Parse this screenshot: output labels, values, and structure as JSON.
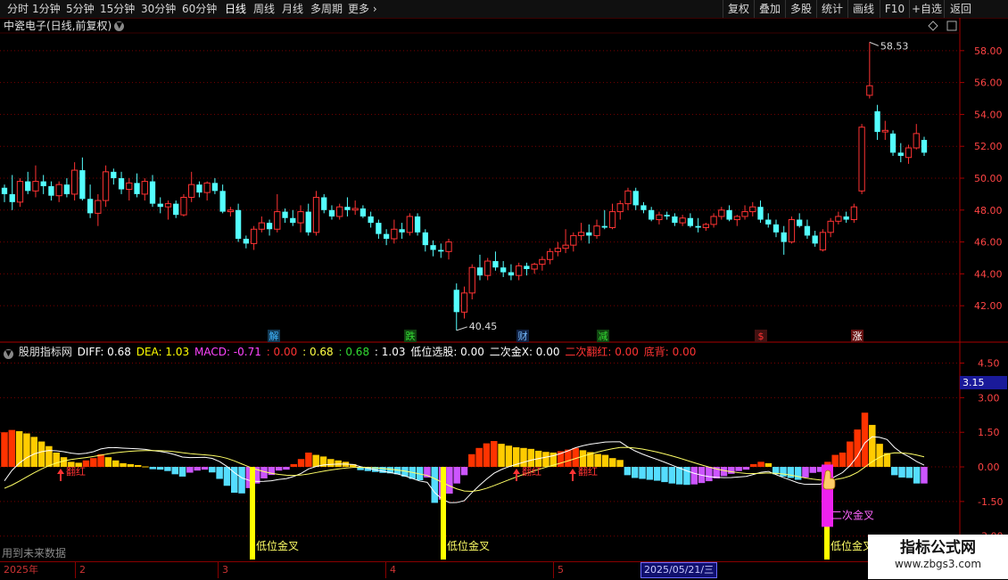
{
  "toolbar": {
    "left": [
      "分时",
      "1分钟",
      "5分钟",
      "15分钟",
      "30分钟",
      "60分钟",
      "日线",
      "周线",
      "月线",
      "多周期",
      "更多"
    ],
    "active": "日线",
    "right": [
      "复权",
      "叠加",
      "多股",
      "统计",
      "画线",
      "F10",
      "+自选",
      "返回"
    ]
  },
  "stock": {
    "title": "中瓷电子(日线,前复权)",
    "high_label": "58.53",
    "low_label": "40.45"
  },
  "price_axis": [
    "58.00",
    "56.00",
    "54.00",
    "52.00",
    "50.00",
    "48.00",
    "46.00",
    "44.00",
    "42.00"
  ],
  "markers": [
    {
      "text": "解",
      "color": "#3fb6ff",
      "bg": "#133a55"
    },
    {
      "text": "跌",
      "color": "#33dd33",
      "bg": "#114411"
    },
    {
      "text": "财",
      "color": "#77bbff",
      "bg": "#112244"
    },
    {
      "text": "减",
      "color": "#33dd33",
      "bg": "#114411"
    },
    {
      "text": "$",
      "color": "#ff3333",
      "bg": "#441111"
    },
    {
      "text": "涨",
      "color": "#ffffff",
      "bg": "#661111"
    }
  ],
  "indicator": {
    "name": "股朋指标网",
    "diff": "DIFF: 0.68",
    "dea": "DEA: 1.03",
    "macd": "MACD: -0.71",
    "v1": ": 0.00",
    "v2": ": 0.68",
    "v3": ": 0.68",
    "v4": ": 1.03",
    "low_pick": "低位选股: 0.00",
    "second_cross": "二次金X: 0.00",
    "second_red": "二次翻红: 0.00",
    "bottom_div": "底背: 0.00"
  },
  "ind_axis": [
    "4.50",
    "3.00",
    "1.50",
    "0.00",
    "-1.50",
    "-3.00"
  ],
  "ind_current": "3.15",
  "signals": {
    "flip_red": "翻红",
    "low_cross": "低位金叉",
    "second_cross": "二次金叉"
  },
  "future_note": "用到未来数据",
  "time_axis": {
    "labels": [
      "2025年",
      "2",
      "3",
      "4",
      "5"
    ],
    "current_date": "2025/05/21/三"
  },
  "watermark": {
    "line1": "指标公式网",
    "line2": "www.zbgs3.com"
  },
  "colors": {
    "up": "#ff3333",
    "down": "#54ffff",
    "grid": "#7a0000"
  },
  "chart_data": [
    {
      "type": "candlestick",
      "title": "中瓷电子(日线,前复权)",
      "ylim": [
        40.5,
        59.5
      ],
      "annotations": [
        {
          "text": "58.53",
          "value": 58.53
        },
        {
          "text": "40.45",
          "value": 40.45
        }
      ],
      "ohlc": [
        [
          49.4,
          49.6,
          48.5,
          49.0
        ],
        [
          49.0,
          50.2,
          48.0,
          48.5
        ],
        [
          48.5,
          50.0,
          48.2,
          49.8
        ],
        [
          49.8,
          50.4,
          49.0,
          49.2
        ],
        [
          49.2,
          50.8,
          48.8,
          49.8
        ],
        [
          49.8,
          50.2,
          49.0,
          49.5
        ],
        [
          49.5,
          49.8,
          48.6,
          48.9
        ],
        [
          48.9,
          49.8,
          48.5,
          49.6
        ],
        [
          49.6,
          50.0,
          48.8,
          49.0
        ],
        [
          49.0,
          51.0,
          48.6,
          50.5
        ],
        [
          50.5,
          51.3,
          48.6,
          48.7
        ],
        [
          48.7,
          49.6,
          47.5,
          47.8
        ],
        [
          47.8,
          49.0,
          47.0,
          48.6
        ],
        [
          48.6,
          50.8,
          48.2,
          50.4
        ],
        [
          50.4,
          50.6,
          49.6,
          50.0
        ],
        [
          50.0,
          50.4,
          49.0,
          49.3
        ],
        [
          49.3,
          50.0,
          48.6,
          49.7
        ],
        [
          49.7,
          50.3,
          48.8,
          49.0
        ],
        [
          49.0,
          50.0,
          48.6,
          49.8
        ],
        [
          49.8,
          50.2,
          48.2,
          48.4
        ],
        [
          48.4,
          48.8,
          47.8,
          48.2
        ],
        [
          48.2,
          48.6,
          47.4,
          48.4
        ],
        [
          48.4,
          48.6,
          47.5,
          47.7
        ],
        [
          47.7,
          49.0,
          47.6,
          48.8
        ],
        [
          48.8,
          50.4,
          48.5,
          49.6
        ],
        [
          49.6,
          49.8,
          48.8,
          49.1
        ],
        [
          49.1,
          49.8,
          48.6,
          49.7
        ],
        [
          49.7,
          50.0,
          49.0,
          49.2
        ],
        [
          49.2,
          49.6,
          47.8,
          47.9
        ],
        [
          47.9,
          48.2,
          47.6,
          48.0
        ],
        [
          48.0,
          48.4,
          46.0,
          46.2
        ],
        [
          46.2,
          46.4,
          45.6,
          45.9
        ],
        [
          45.9,
          47.0,
          45.5,
          46.8
        ],
        [
          46.8,
          47.6,
          46.6,
          47.2
        ],
        [
          47.2,
          47.4,
          46.4,
          46.8
        ],
        [
          46.8,
          49.0,
          46.6,
          47.9
        ],
        [
          47.9,
          48.1,
          47.2,
          47.5
        ],
        [
          47.5,
          48.0,
          47.0,
          47.2
        ],
        [
          47.2,
          48.3,
          46.6,
          47.9
        ],
        [
          47.9,
          48.4,
          46.4,
          46.6
        ],
        [
          46.6,
          49.2,
          46.4,
          48.8
        ],
        [
          48.8,
          49.0,
          47.8,
          48.0
        ],
        [
          48.0,
          48.3,
          47.4,
          47.6
        ],
        [
          47.6,
          48.4,
          47.4,
          48.2
        ],
        [
          48.2,
          48.8,
          47.6,
          48.0
        ],
        [
          48.0,
          48.6,
          47.7,
          48.1
        ],
        [
          48.1,
          48.3,
          47.5,
          47.6
        ],
        [
          47.6,
          47.9,
          46.9,
          47.2
        ],
        [
          47.2,
          47.4,
          46.2,
          46.5
        ],
        [
          46.5,
          46.8,
          45.8,
          46.2
        ],
        [
          46.2,
          47.4,
          45.9,
          46.8
        ],
        [
          46.8,
          47.2,
          46.2,
          46.6
        ],
        [
          46.6,
          47.8,
          46.4,
          47.6
        ],
        [
          47.6,
          47.8,
          46.4,
          46.6
        ],
        [
          46.6,
          46.8,
          45.4,
          45.8
        ],
        [
          45.8,
          46.1,
          45.1,
          45.5
        ],
        [
          45.5,
          45.9,
          45.0,
          45.4
        ],
        [
          45.4,
          46.2,
          44.9,
          46.0
        ],
        [
          43.0,
          43.4,
          40.45,
          41.6
        ],
        [
          41.6,
          43.2,
          41.2,
          42.8
        ],
        [
          42.8,
          44.6,
          42.4,
          44.4
        ],
        [
          44.4,
          45.2,
          43.6,
          43.9
        ],
        [
          43.9,
          45.0,
          43.6,
          44.8
        ],
        [
          44.8,
          45.4,
          44.2,
          44.4
        ],
        [
          44.4,
          44.8,
          43.8,
          44.1
        ],
        [
          44.1,
          44.6,
          43.6,
          43.9
        ],
        [
          43.9,
          44.7,
          43.6,
          44.5
        ],
        [
          44.5,
          44.7,
          43.9,
          44.3
        ],
        [
          44.3,
          44.7,
          44.0,
          44.6
        ],
        [
          44.6,
          45.1,
          44.2,
          44.9
        ],
        [
          44.9,
          45.6,
          44.6,
          45.4
        ],
        [
          45.4,
          46.0,
          45.1,
          45.6
        ],
        [
          45.6,
          46.8,
          45.3,
          45.8
        ],
        [
          45.8,
          46.6,
          45.4,
          46.4
        ],
        [
          46.4,
          47.2,
          46.1,
          46.6
        ],
        [
          46.6,
          47.1,
          45.9,
          46.4
        ],
        [
          46.4,
          47.4,
          46.2,
          47.0
        ],
        [
          47.0,
          48.0,
          46.8,
          46.9
        ],
        [
          46.9,
          48.4,
          46.8,
          47.9
        ],
        [
          47.9,
          48.6,
          47.4,
          48.4
        ],
        [
          48.4,
          49.4,
          48.0,
          49.2
        ],
        [
          49.2,
          49.4,
          48.0,
          48.3
        ],
        [
          48.3,
          48.5,
          47.8,
          48.0
        ],
        [
          48.0,
          48.2,
          47.3,
          47.4
        ],
        [
          47.4,
          47.9,
          47.1,
          47.7
        ],
        [
          47.7,
          47.9,
          47.4,
          47.6
        ],
        [
          47.6,
          47.8,
          47.0,
          47.2
        ],
        [
          47.2,
          47.7,
          47.0,
          47.5
        ],
        [
          47.5,
          47.8,
          46.9,
          47.0
        ],
        [
          47.0,
          47.5,
          46.6,
          46.9
        ],
        [
          46.9,
          47.2,
          46.7,
          47.1
        ],
        [
          47.1,
          47.8,
          46.9,
          47.6
        ],
        [
          47.6,
          48.2,
          47.4,
          48.0
        ],
        [
          48.0,
          48.3,
          47.3,
          47.4
        ],
        [
          47.4,
          47.7,
          47.0,
          47.6
        ],
        [
          47.6,
          48.3,
          47.4,
          47.9
        ],
        [
          47.9,
          48.5,
          47.6,
          48.2
        ],
        [
          48.2,
          48.6,
          47.2,
          47.4
        ],
        [
          47.4,
          47.8,
          46.9,
          47.1
        ],
        [
          47.1,
          47.4,
          46.3,
          46.6
        ],
        [
          46.6,
          47.0,
          45.2,
          46.0
        ],
        [
          46.0,
          47.6,
          45.9,
          47.4
        ],
        [
          47.4,
          47.8,
          46.9,
          47.0
        ],
        [
          47.0,
          47.4,
          46.2,
          46.4
        ],
        [
          46.4,
          46.7,
          45.7,
          45.9
        ],
        [
          45.5,
          46.8,
          45.4,
          46.6
        ],
        [
          46.6,
          47.5,
          46.3,
          47.3
        ],
        [
          47.3,
          47.9,
          47.1,
          47.6
        ],
        [
          47.6,
          47.9,
          47.2,
          47.4
        ],
        [
          47.4,
          48.4,
          47.2,
          48.2
        ],
        [
          49.2,
          53.4,
          49.0,
          53.2
        ],
        [
          55.2,
          58.53,
          55.0,
          55.8
        ],
        [
          54.2,
          54.6,
          52.4,
          52.9
        ],
        [
          52.9,
          53.6,
          52.4,
          53.0
        ],
        [
          52.8,
          53.0,
          51.4,
          51.6
        ],
        [
          51.6,
          52.2,
          51.0,
          51.4
        ],
        [
          51.3,
          52.1,
          50.9,
          51.9
        ],
        [
          51.9,
          53.4,
          51.8,
          52.8
        ],
        [
          52.4,
          52.6,
          51.4,
          51.6
        ]
      ]
    },
    {
      "type": "bar",
      "title": "MACD",
      "ylim": [
        -3.9,
        5.1
      ],
      "values": [
        1.5,
        1.6,
        1.55,
        1.45,
        1.3,
        1.1,
        0.9,
        0.62,
        0.42,
        0.22,
        0.18,
        0.28,
        0.38,
        0.55,
        0.42,
        0.28,
        0.16,
        0.12,
        0.08,
        0.02,
        -0.1,
        -0.12,
        -0.18,
        -0.32,
        -0.42,
        -0.25,
        -0.16,
        -0.12,
        -0.24,
        -0.52,
        -0.82,
        -1.12,
        -1.15,
        -0.92,
        -0.72,
        -0.5,
        -0.35,
        -0.16,
        -0.12,
        0.12,
        0.34,
        0.62,
        0.52,
        0.45,
        0.34,
        0.28,
        0.22,
        0.12,
        -0.14,
        -0.18,
        -0.22,
        -0.26,
        -0.28,
        -0.32,
        -0.42,
        -0.52,
        -0.58,
        -0.46,
        -1.56,
        -1.42,
        -1.16,
        -0.72,
        -0.36,
        0.55,
        0.82,
        1.02,
        1.12,
        1.0,
        0.92,
        0.85,
        0.82,
        0.78,
        0.7,
        0.65,
        0.62,
        0.68,
        0.75,
        0.82,
        0.72,
        0.64,
        0.56,
        0.52,
        0.38,
        0.3,
        -0.36,
        -0.48,
        -0.52,
        -0.56,
        -0.6,
        -0.66,
        -0.72,
        -0.76,
        -0.78,
        -0.76,
        -0.7,
        -0.62,
        -0.5,
        -0.4,
        -0.3,
        -0.18,
        -0.12,
        0.12,
        0.22,
        0.16,
        -0.32,
        -0.42,
        -0.48,
        -0.56,
        -0.46,
        -0.26,
        -0.22,
        0.22,
        0.52,
        0.62,
        1.1,
        1.62,
        2.35,
        1.82,
        1.0,
        0.6,
        -0.36,
        -0.46,
        -0.48,
        -0.72,
        -0.72
      ]
    }
  ]
}
